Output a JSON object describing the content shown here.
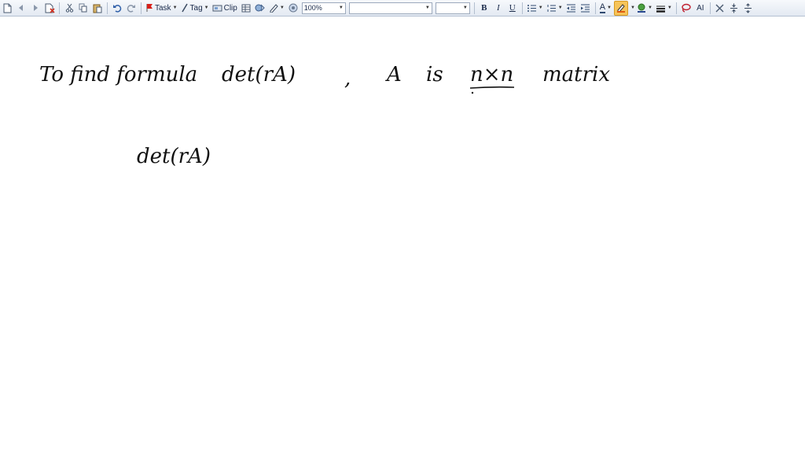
{
  "toolbar": {
    "task_label": "Task",
    "tag_label": "Tag",
    "clip_label": "Clip",
    "zoom_value": "100%",
    "font_family_value": "",
    "font_size_value": "",
    "bold_label": "B",
    "italic_label": "I",
    "underline_label": "U",
    "font_color_label": "A",
    "text_size_label": "AI",
    "highlight_color": "#f0a830",
    "icons": [
      "new-page-icon",
      "back-icon",
      "forward-icon",
      "delete-page-icon",
      "cut-icon",
      "copy-icon",
      "paste-icon",
      "undo-icon",
      "redo-icon",
      "task-flag-icon",
      "tag-icon",
      "clip-icon",
      "table-icon",
      "insert-image-icon",
      "pen-icon",
      "help-icon",
      "bullets-icon",
      "numbering-icon",
      "decrease-indent-icon",
      "increase-indent-icon",
      "font-color-icon",
      "highlighter-icon",
      "pen-color-icon",
      "line-style-icon",
      "lasso-icon",
      "delete-icon",
      "spacing-icon"
    ]
  },
  "note": {
    "line1": {
      "part1": "To find formula",
      "part2": "det(rA)",
      "part3": ",",
      "part4": "A",
      "part5": "is",
      "part6": "n×n",
      "part7": "matrix"
    },
    "line2": "det(rA)"
  }
}
